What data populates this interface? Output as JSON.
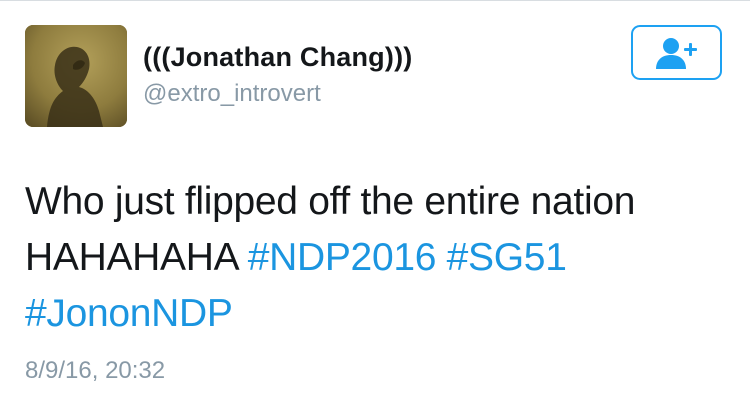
{
  "tweet": {
    "author": {
      "display_name": "(((Jonathan Chang)))",
      "handle": "@extro_introvert",
      "avatar_icon": "profile-photo-silhouette"
    },
    "follow_button": {
      "icon": "add-user-icon",
      "color": "#1da1f2"
    },
    "text": {
      "line1": "Who just flipped off the entire nation",
      "line2_plain": "HAHAHAHA",
      "hashtags": [
        "#NDP2016",
        "#SG51",
        "#JononNDP"
      ]
    },
    "timestamp": "8/9/16, 20:32"
  },
  "colors": {
    "text": "#14171a",
    "secondary": "#8899a6",
    "link": "#1b95e0",
    "accent": "#1da1f2"
  }
}
